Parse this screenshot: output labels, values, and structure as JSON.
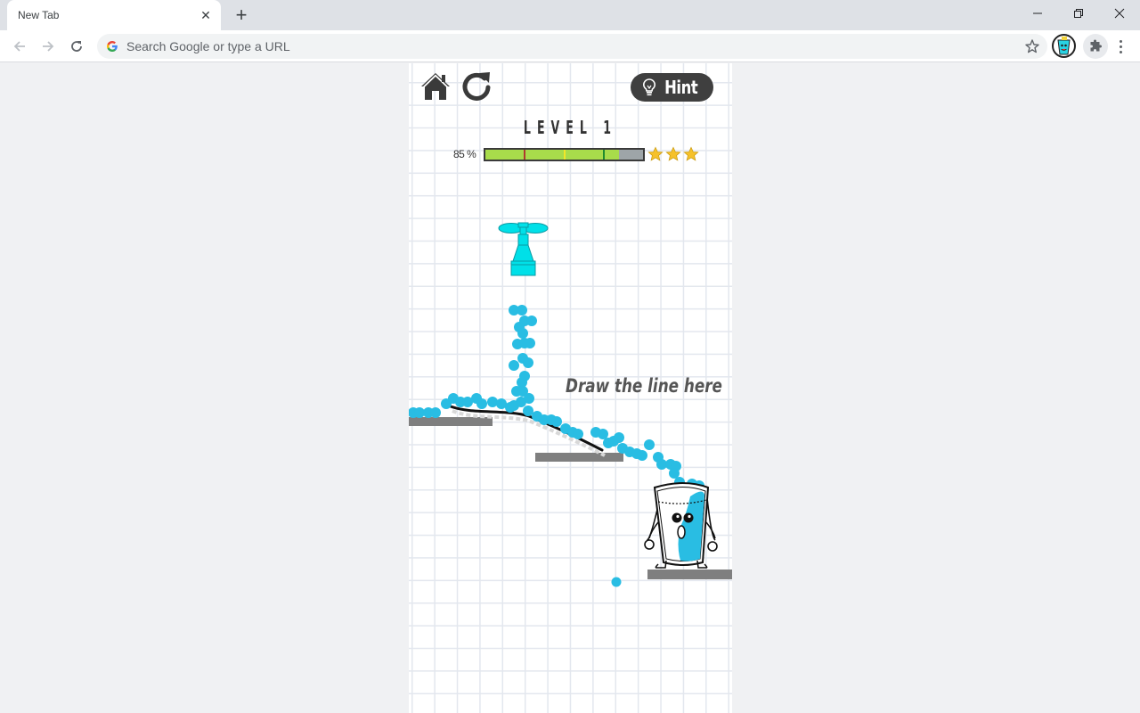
{
  "browser": {
    "tab_title": "New Tab",
    "omnibox_placeholder": "Search Google or type a URL",
    "omnibox_value": ""
  },
  "icons": {
    "back": "arrow-left-icon",
    "forward": "arrow-right-icon",
    "reload": "reload-icon",
    "google": "google-logo-icon",
    "bookmark": "star-outline-icon",
    "extensions": "puzzle-icon",
    "menu": "kebab-menu-icon",
    "minimize": "minimize-icon",
    "maximize": "restore-icon",
    "close": "close-icon"
  },
  "game": {
    "home_icon": "home-icon",
    "restart_icon": "restart-icon",
    "hint_label": "Hint",
    "level_title": "LEVEL 1",
    "progress_label": "85 %",
    "progress_percent": 85,
    "thresholds": [
      {
        "percent": 25,
        "color": "#b03a2e"
      },
      {
        "percent": 50,
        "color": "#f2e628"
      },
      {
        "percent": 75,
        "color": "#1f8c2e"
      }
    ],
    "stars_earned": 3,
    "stars_total": 3,
    "draw_hint": "Draw the line here",
    "colors": {
      "water": "#29bde3",
      "faucet": "#00e0e8",
      "platform": "#7f7f7f",
      "fill": "#a8dc4b",
      "empty": "#9ea5a8",
      "star": "#f6c12a",
      "hint_button": "#3f3f3f"
    }
  }
}
